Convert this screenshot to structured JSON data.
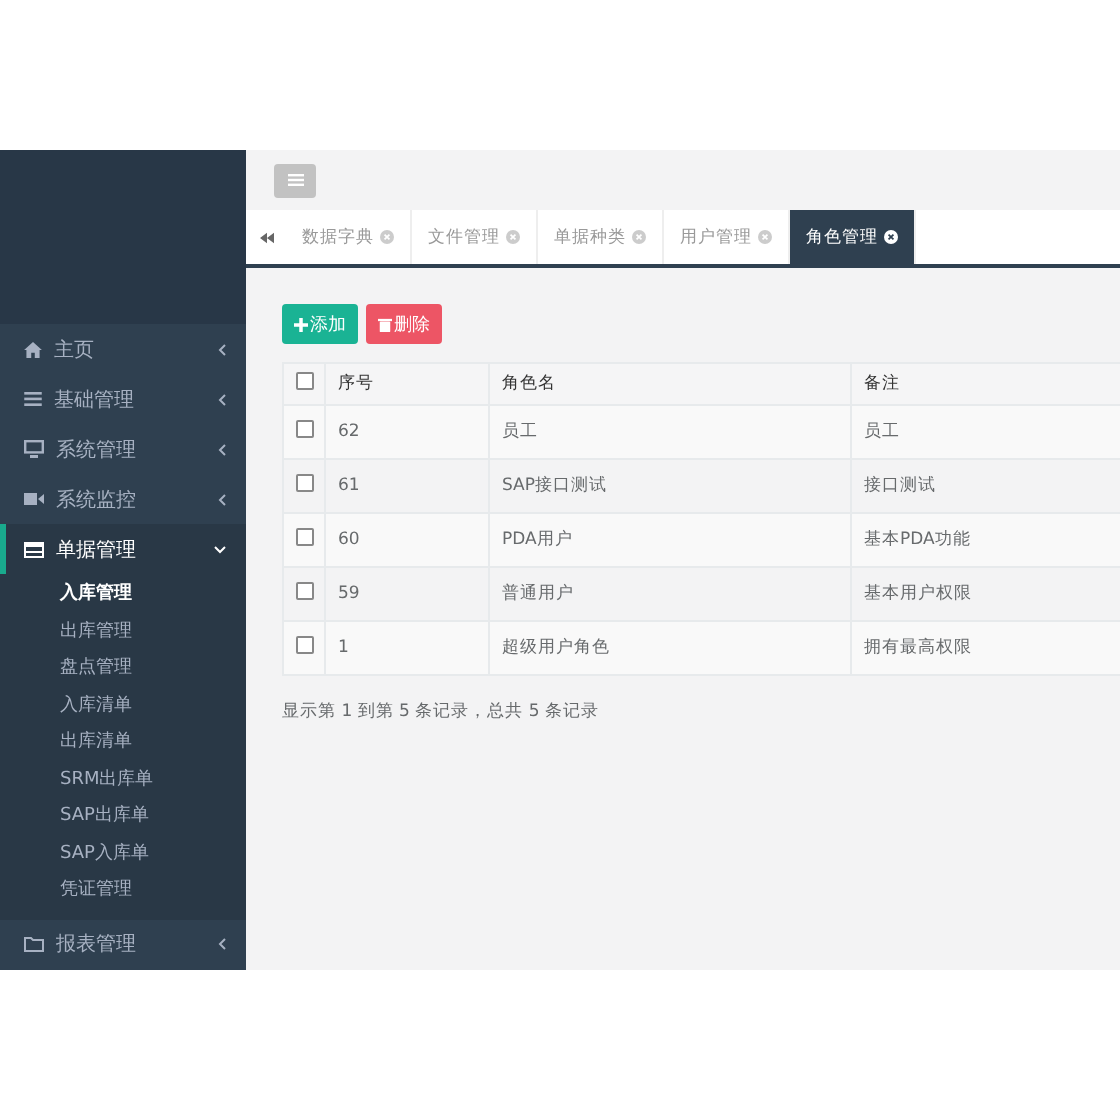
{
  "sidebar": {
    "items": [
      {
        "label": "主页",
        "expanded": false
      },
      {
        "label": "基础管理",
        "expanded": false
      },
      {
        "label": "系统管理",
        "expanded": false
      },
      {
        "label": "系统监控",
        "expanded": false
      },
      {
        "label": "单据管理",
        "expanded": true,
        "children": [
          {
            "label": "入库管理",
            "selected": true
          },
          {
            "label": "出库管理",
            "selected": false
          },
          {
            "label": "盘点管理",
            "selected": false
          },
          {
            "label": "入库清单",
            "selected": false
          },
          {
            "label": "出库清单",
            "selected": false
          },
          {
            "label": "SRM出库单",
            "selected": false
          },
          {
            "label": "SAP出库单",
            "selected": false
          },
          {
            "label": "SAP入库单",
            "selected": false
          },
          {
            "label": "凭证管理",
            "selected": false
          }
        ]
      },
      {
        "label": "报表管理",
        "expanded": false
      }
    ]
  },
  "tabs": [
    {
      "label": "数据字典",
      "selected": false
    },
    {
      "label": "文件管理",
      "selected": false
    },
    {
      "label": "单据种类",
      "selected": false
    },
    {
      "label": "用户管理",
      "selected": false
    },
    {
      "label": "角色管理",
      "selected": true
    }
  ],
  "toolbar": {
    "buttons": [
      {
        "kind": "add",
        "label": "添加"
      },
      {
        "kind": "delete",
        "label": "删除"
      }
    ]
  },
  "table": {
    "header_checked": false,
    "columns": [
      "序号",
      "角色名",
      "备注"
    ],
    "rows": [
      {
        "checked": false,
        "cells": [
          "62",
          "员工",
          "员工"
        ]
      },
      {
        "checked": false,
        "cells": [
          "61",
          "SAP接口测试",
          "接口测试"
        ]
      },
      {
        "checked": false,
        "cells": [
          "60",
          "PDA用户",
          "基本PDA功能"
        ]
      },
      {
        "checked": false,
        "cells": [
          "59",
          "普通用户",
          "基本用户权限"
        ]
      },
      {
        "checked": false,
        "cells": [
          "1",
          "超级用户角色",
          "拥有最高权限"
        ]
      }
    ]
  },
  "pagination": {
    "summary": "显示第 1 到第 5 条记录，总共 5 条记录"
  }
}
